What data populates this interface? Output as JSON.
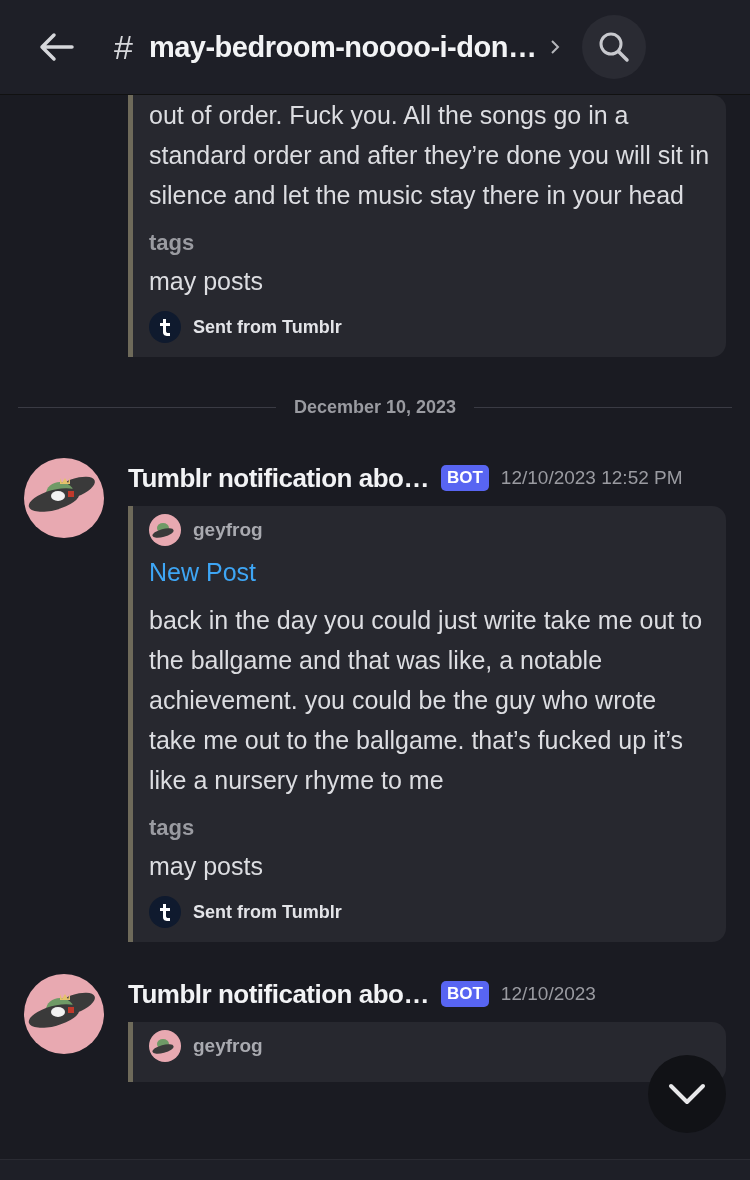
{
  "header": {
    "channel_symbol": "#",
    "title": "may-bedroom-noooo-i-don…"
  },
  "top_embed": {
    "text": "out of order. Fuck you. All the songs go in a standard order and after they’re done you will sit in silence and let the music stay there in your head",
    "tags_label": "tags",
    "tags": "may posts",
    "footer": "Sent from Tumblr"
  },
  "date_divider": "December 10, 2023",
  "messages": [
    {
      "author": "Tumblr notification abo…",
      "badge": "BOT",
      "timestamp": "12/10/2023 12:52 PM",
      "embed": {
        "author": "geyfrog",
        "title": "New Post",
        "text": "back in the day you could just write take me out to the ballgame and that was like, a notable achievement. you could be the guy who wrote take me out to the ballgame. that’s fucked up it’s like a nursery rhyme to me",
        "tags_label": "tags",
        "tags": "may posts",
        "footer": "Sent from Tumblr"
      }
    },
    {
      "author": "Tumblr notification abo…",
      "badge": "BOT",
      "timestamp": "12/10/2023",
      "embed": {
        "author": "geyfrog"
      }
    }
  ]
}
